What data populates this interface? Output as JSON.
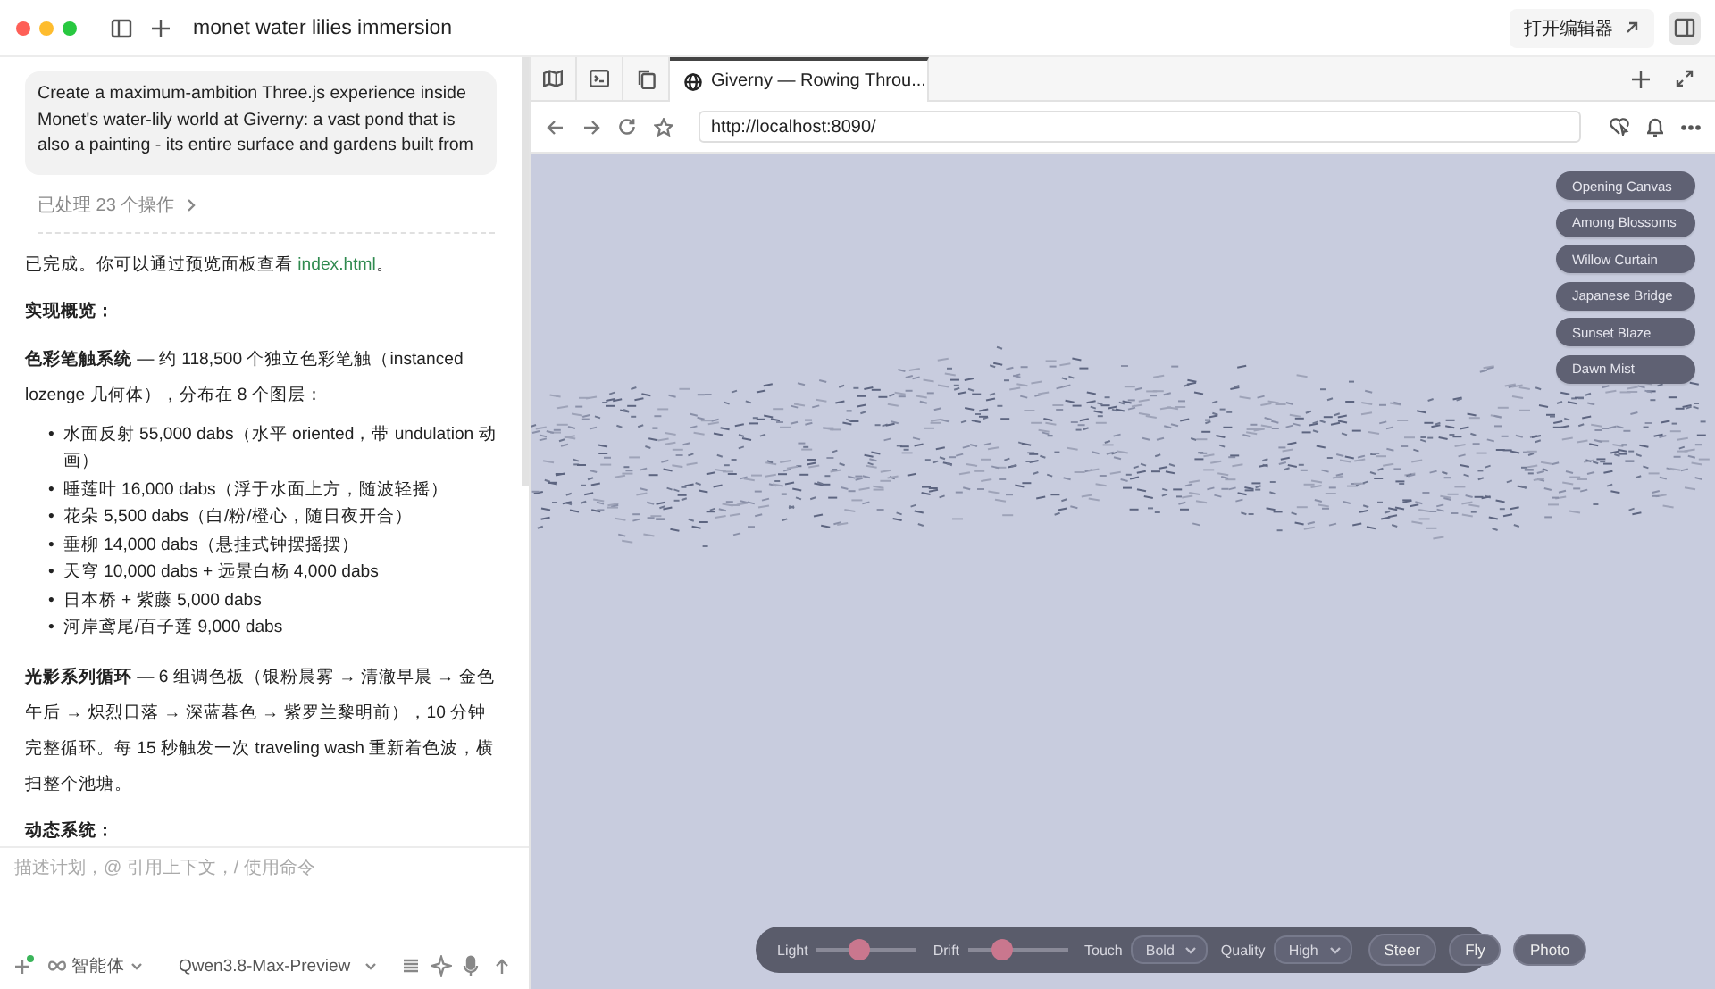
{
  "window": {
    "title": "monet water lilies immersion",
    "open_editor": "打开编辑器"
  },
  "chat": {
    "prompt": "Create a maximum-ambition Three.js experience inside Monet's water-lily world at Giverny: a vast pond that is also a painting - its entire surface and gardens built from",
    "processed": "已处理 23 个操作",
    "blocks": [
      {
        "kind": "link_paragraph",
        "before": "已完成。你可以通过预览面板查看 ",
        "link": "index.html",
        "after": "。"
      },
      {
        "kind": "heading",
        "text": "实现概览："
      },
      {
        "kind": "paragraph",
        "text": "**色彩笔触系统** — 约 118,500 个独立色彩笔触（instanced lozenge 几何体），分布在 8 个图层："
      },
      {
        "kind": "list",
        "marker": "•",
        "items": [
          "水面反射 55,000 dabs（水平 oriented，带 undulation 动画）",
          "睡莲叶 16,000 dabs（浮于水面上方，随波轻摇）",
          "花朵 5,500 dabs（白/粉/橙心，随日夜开合）",
          "垂柳 14,000 dabs（悬挂式钟摆摇摆）",
          "天穹 10,000 dabs + 远景白杨 4,000 dabs",
          "日本桥 + 紫藤 5,000 dabs",
          "河岸鸢尾/百子莲 9,000 dabs"
        ]
      },
      {
        "kind": "paragraph",
        "text": "**光影系列循环** — 6 组调色板（银粉晨雾 → 清澈早晨 → 金色午后 → 炽烈日落 → 深蓝暮色 → 紫罗兰黎明前），10 分钟完整循环。每 15 秒触发一次 traveling wash 重新着色波，横扫整个池塘。"
      },
      {
        "kind": "heading",
        "text": "动态系统："
      }
    ],
    "composer": {
      "placeholder": "描述计划，@ 引用上下文，/ 使用命令",
      "mode": "智能体",
      "model": "Qwen3.8-Max-Preview"
    }
  },
  "browser": {
    "tabs": [
      {
        "title": "Giverny — Rowing Throu...",
        "selected": true
      }
    ],
    "url": "http://localhost:8090/",
    "scenes": [
      {
        "label": "Opening Canvas"
      },
      {
        "label": "Among Blossoms"
      },
      {
        "label": "Willow Curtain"
      },
      {
        "label": "Japanese Bridge"
      },
      {
        "label": "Sunset Blaze"
      },
      {
        "label": "Dawn Mist"
      }
    ],
    "controls": {
      "sliders": [
        {
          "label": "Light",
          "level": 0.4
        },
        {
          "label": "Drift",
          "level": 0.3
        }
      ],
      "selects": [
        {
          "label": "Touch",
          "value": "Bold"
        },
        {
          "label": "Quality",
          "value": "High"
        }
      ],
      "buttons": [
        "Steer",
        "Fly",
        "Photo"
      ]
    }
  }
}
